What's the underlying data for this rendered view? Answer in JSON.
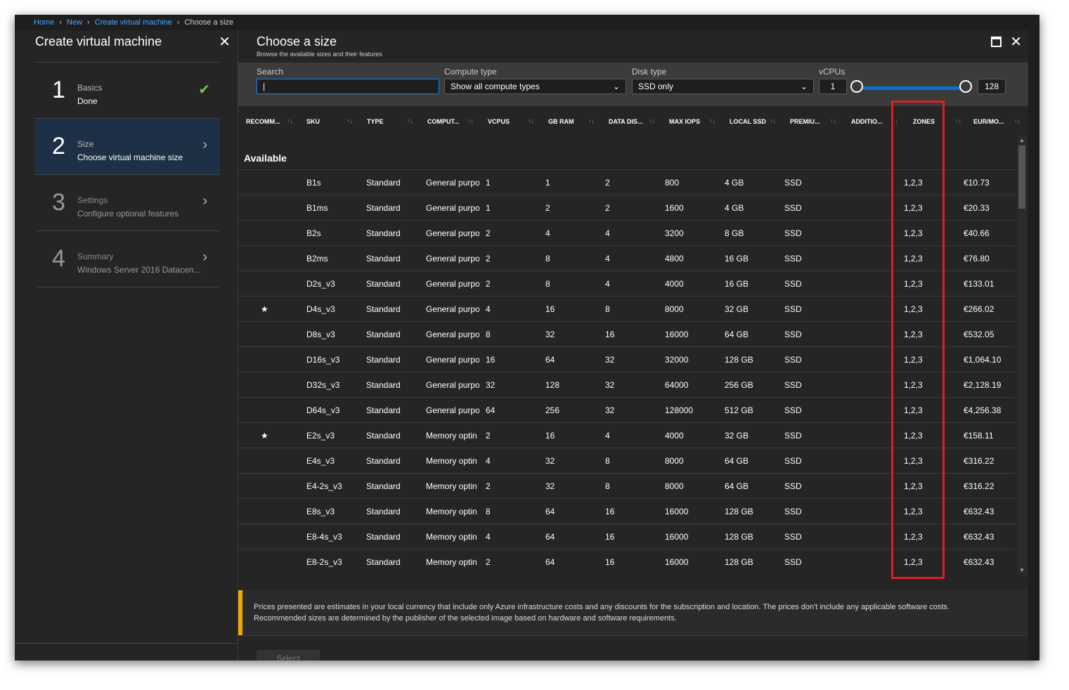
{
  "breadcrumb": [
    "Home",
    "New",
    "Create virtual machine",
    "Choose a size"
  ],
  "left_blade": {
    "title": "Create virtual machine",
    "steps": [
      {
        "num": "1",
        "label": "Basics",
        "sub": "Done"
      },
      {
        "num": "2",
        "label": "Size",
        "sub": "Choose virtual machine size"
      },
      {
        "num": "3",
        "label": "Settings",
        "sub": "Configure optional features"
      },
      {
        "num": "4",
        "label": "Summary",
        "sub": "Windows Server 2016 Datacen..."
      }
    ]
  },
  "right_blade": {
    "title": "Choose a size",
    "subtitle": "Browse the available sizes and their features"
  },
  "filters": {
    "search_label": "Search",
    "search_value": "",
    "compute_label": "Compute type",
    "compute_value": "Show all compute types",
    "disk_label": "Disk type",
    "disk_value": "SSD only",
    "vcpu_label": "vCPUs",
    "vcpu_min": "1",
    "vcpu_max": "128"
  },
  "columns": [
    "RECOMM...",
    "SKU",
    "TYPE",
    "COMPUT...",
    "VCPUS",
    "GB RAM",
    "DATA DIS...",
    "MAX IOPS",
    "LOCAL SSD",
    "PREMIU...",
    "ADDITIO...",
    "ZONES",
    "EUR/MO..."
  ],
  "group_label": "Available",
  "rows": [
    {
      "rec": "",
      "sku": "B1s",
      "type": "Standard",
      "compute": "General purpo",
      "vcpus": "1",
      "ram": "1",
      "disks": "2",
      "iops": "800",
      "ssd": "4 GB",
      "premium": "SSD",
      "zones": "1,2,3",
      "price": "€10.73"
    },
    {
      "rec": "",
      "sku": "B1ms",
      "type": "Standard",
      "compute": "General purpo",
      "vcpus": "1",
      "ram": "2",
      "disks": "2",
      "iops": "1600",
      "ssd": "4 GB",
      "premium": "SSD",
      "zones": "1,2,3",
      "price": "€20.33"
    },
    {
      "rec": "",
      "sku": "B2s",
      "type": "Standard",
      "compute": "General purpo",
      "vcpus": "2",
      "ram": "4",
      "disks": "4",
      "iops": "3200",
      "ssd": "8 GB",
      "premium": "SSD",
      "zones": "1,2,3",
      "price": "€40.66"
    },
    {
      "rec": "",
      "sku": "B2ms",
      "type": "Standard",
      "compute": "General purpo",
      "vcpus": "2",
      "ram": "8",
      "disks": "4",
      "iops": "4800",
      "ssd": "16 GB",
      "premium": "SSD",
      "zones": "1,2,3",
      "price": "€76.80"
    },
    {
      "rec": "",
      "sku": "D2s_v3",
      "type": "Standard",
      "compute": "General purpo",
      "vcpus": "2",
      "ram": "8",
      "disks": "4",
      "iops": "4000",
      "ssd": "16 GB",
      "premium": "SSD",
      "zones": "1,2,3",
      "price": "€133.01"
    },
    {
      "rec": "★",
      "sku": "D4s_v3",
      "type": "Standard",
      "compute": "General purpo",
      "vcpus": "4",
      "ram": "16",
      "disks": "8",
      "iops": "8000",
      "ssd": "32 GB",
      "premium": "SSD",
      "zones": "1,2,3",
      "price": "€266.02"
    },
    {
      "rec": "",
      "sku": "D8s_v3",
      "type": "Standard",
      "compute": "General purpo",
      "vcpus": "8",
      "ram": "32",
      "disks": "16",
      "iops": "16000",
      "ssd": "64 GB",
      "premium": "SSD",
      "zones": "1,2,3",
      "price": "€532.05"
    },
    {
      "rec": "",
      "sku": "D16s_v3",
      "type": "Standard",
      "compute": "General purpo",
      "vcpus": "16",
      "ram": "64",
      "disks": "32",
      "iops": "32000",
      "ssd": "128 GB",
      "premium": "SSD",
      "zones": "1,2,3",
      "price": "€1,064.10"
    },
    {
      "rec": "",
      "sku": "D32s_v3",
      "type": "Standard",
      "compute": "General purpo",
      "vcpus": "32",
      "ram": "128",
      "disks": "32",
      "iops": "64000",
      "ssd": "256 GB",
      "premium": "SSD",
      "zones": "1,2,3",
      "price": "€2,128.19"
    },
    {
      "rec": "",
      "sku": "D64s_v3",
      "type": "Standard",
      "compute": "General purpo",
      "vcpus": "64",
      "ram": "256",
      "disks": "32",
      "iops": "128000",
      "ssd": "512 GB",
      "premium": "SSD",
      "zones": "1,2,3",
      "price": "€4,256.38"
    },
    {
      "rec": "★",
      "sku": "E2s_v3",
      "type": "Standard",
      "compute": "Memory optin",
      "vcpus": "2",
      "ram": "16",
      "disks": "4",
      "iops": "4000",
      "ssd": "32 GB",
      "premium": "SSD",
      "zones": "1,2,3",
      "price": "€158.11"
    },
    {
      "rec": "",
      "sku": "E4s_v3",
      "type": "Standard",
      "compute": "Memory optin",
      "vcpus": "4",
      "ram": "32",
      "disks": "8",
      "iops": "8000",
      "ssd": "64 GB",
      "premium": "SSD",
      "zones": "1,2,3",
      "price": "€316.22"
    },
    {
      "rec": "",
      "sku": "E4-2s_v3",
      "type": "Standard",
      "compute": "Memory optin",
      "vcpus": "2",
      "ram": "32",
      "disks": "8",
      "iops": "8000",
      "ssd": "64 GB",
      "premium": "SSD",
      "zones": "1,2,3",
      "price": "€316.22"
    },
    {
      "rec": "",
      "sku": "E8s_v3",
      "type": "Standard",
      "compute": "Memory optin",
      "vcpus": "8",
      "ram": "64",
      "disks": "16",
      "iops": "16000",
      "ssd": "128 GB",
      "premium": "SSD",
      "zones": "1,2,3",
      "price": "€632.43"
    },
    {
      "rec": "",
      "sku": "E8-4s_v3",
      "type": "Standard",
      "compute": "Memory optin",
      "vcpus": "4",
      "ram": "64",
      "disks": "16",
      "iops": "16000",
      "ssd": "128 GB",
      "premium": "SSD",
      "zones": "1,2,3",
      "price": "€632.43"
    },
    {
      "rec": "",
      "sku": "E8-2s_v3",
      "type": "Standard",
      "compute": "Memory optin",
      "vcpus": "2",
      "ram": "64",
      "disks": "16",
      "iops": "16000",
      "ssd": "128 GB",
      "premium": "SSD",
      "zones": "1,2,3",
      "price": "€632.43"
    }
  ],
  "note_line1": "Prices presented are estimates in your local currency that include only Azure infrastructure costs and any discounts for the subscription and location. The prices don't include any applicable software costs.",
  "note_line2": "Recommended sizes are determined by the publisher of the selected image based on hardware and software requirements.",
  "select_label": "Select",
  "colors": {
    "accent": "#0a84ff",
    "highlight": "#e01e1e",
    "warning": "#f2a900",
    "success": "#7cc243"
  },
  "icons": {
    "close": "close-icon",
    "maximize": "maximize-icon",
    "check": "checkmark-icon",
    "chevron": "chevron-right-icon",
    "star": "star-icon"
  }
}
